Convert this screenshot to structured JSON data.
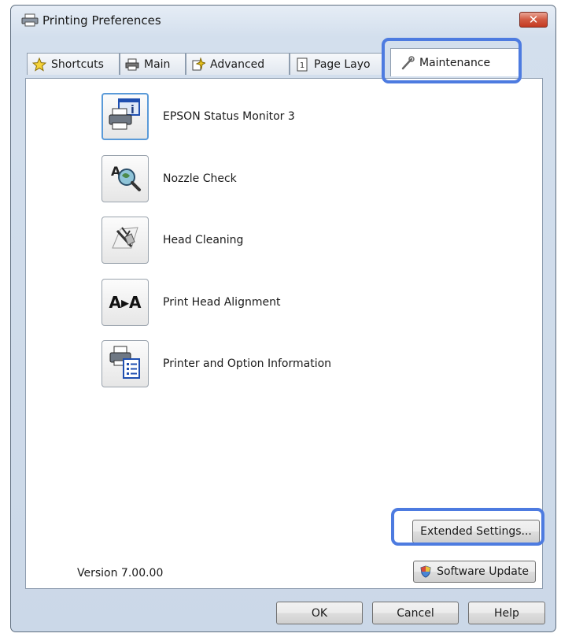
{
  "window": {
    "title": "Printing Preferences",
    "close_label": "✕"
  },
  "tabs": [
    {
      "label": "Shortcuts",
      "icon": "star-icon"
    },
    {
      "label": "Main",
      "icon": "printer-icon"
    },
    {
      "label": "Advanced",
      "icon": "advanced-icon"
    },
    {
      "label": "Page Layo",
      "icon": "page-layout-icon"
    },
    {
      "label": "Maintenance",
      "icon": "wrench-icon",
      "active": true
    }
  ],
  "maintenance": {
    "items": [
      {
        "label": "EPSON Status Monitor 3",
        "icon": "status-monitor-icon"
      },
      {
        "label": "Nozzle Check",
        "icon": "nozzle-check-icon"
      },
      {
        "label": "Head Cleaning",
        "icon": "head-cleaning-icon"
      },
      {
        "label": "Print Head Alignment",
        "icon": "alignment-icon",
        "glyph": "A▸A"
      },
      {
        "label": "Printer and Option Information",
        "icon": "printer-info-icon"
      }
    ],
    "extended_settings_label": "Extended Settings...",
    "software_update_label": "Software Update",
    "version": "Version 7.00.00"
  },
  "footer": {
    "ok_label": "OK",
    "cancel_label": "Cancel",
    "help_label": "Help"
  },
  "colors": {
    "highlight": "#4d7be0",
    "selected_border": "#5a9ad8",
    "close_red": "#c43a22"
  }
}
